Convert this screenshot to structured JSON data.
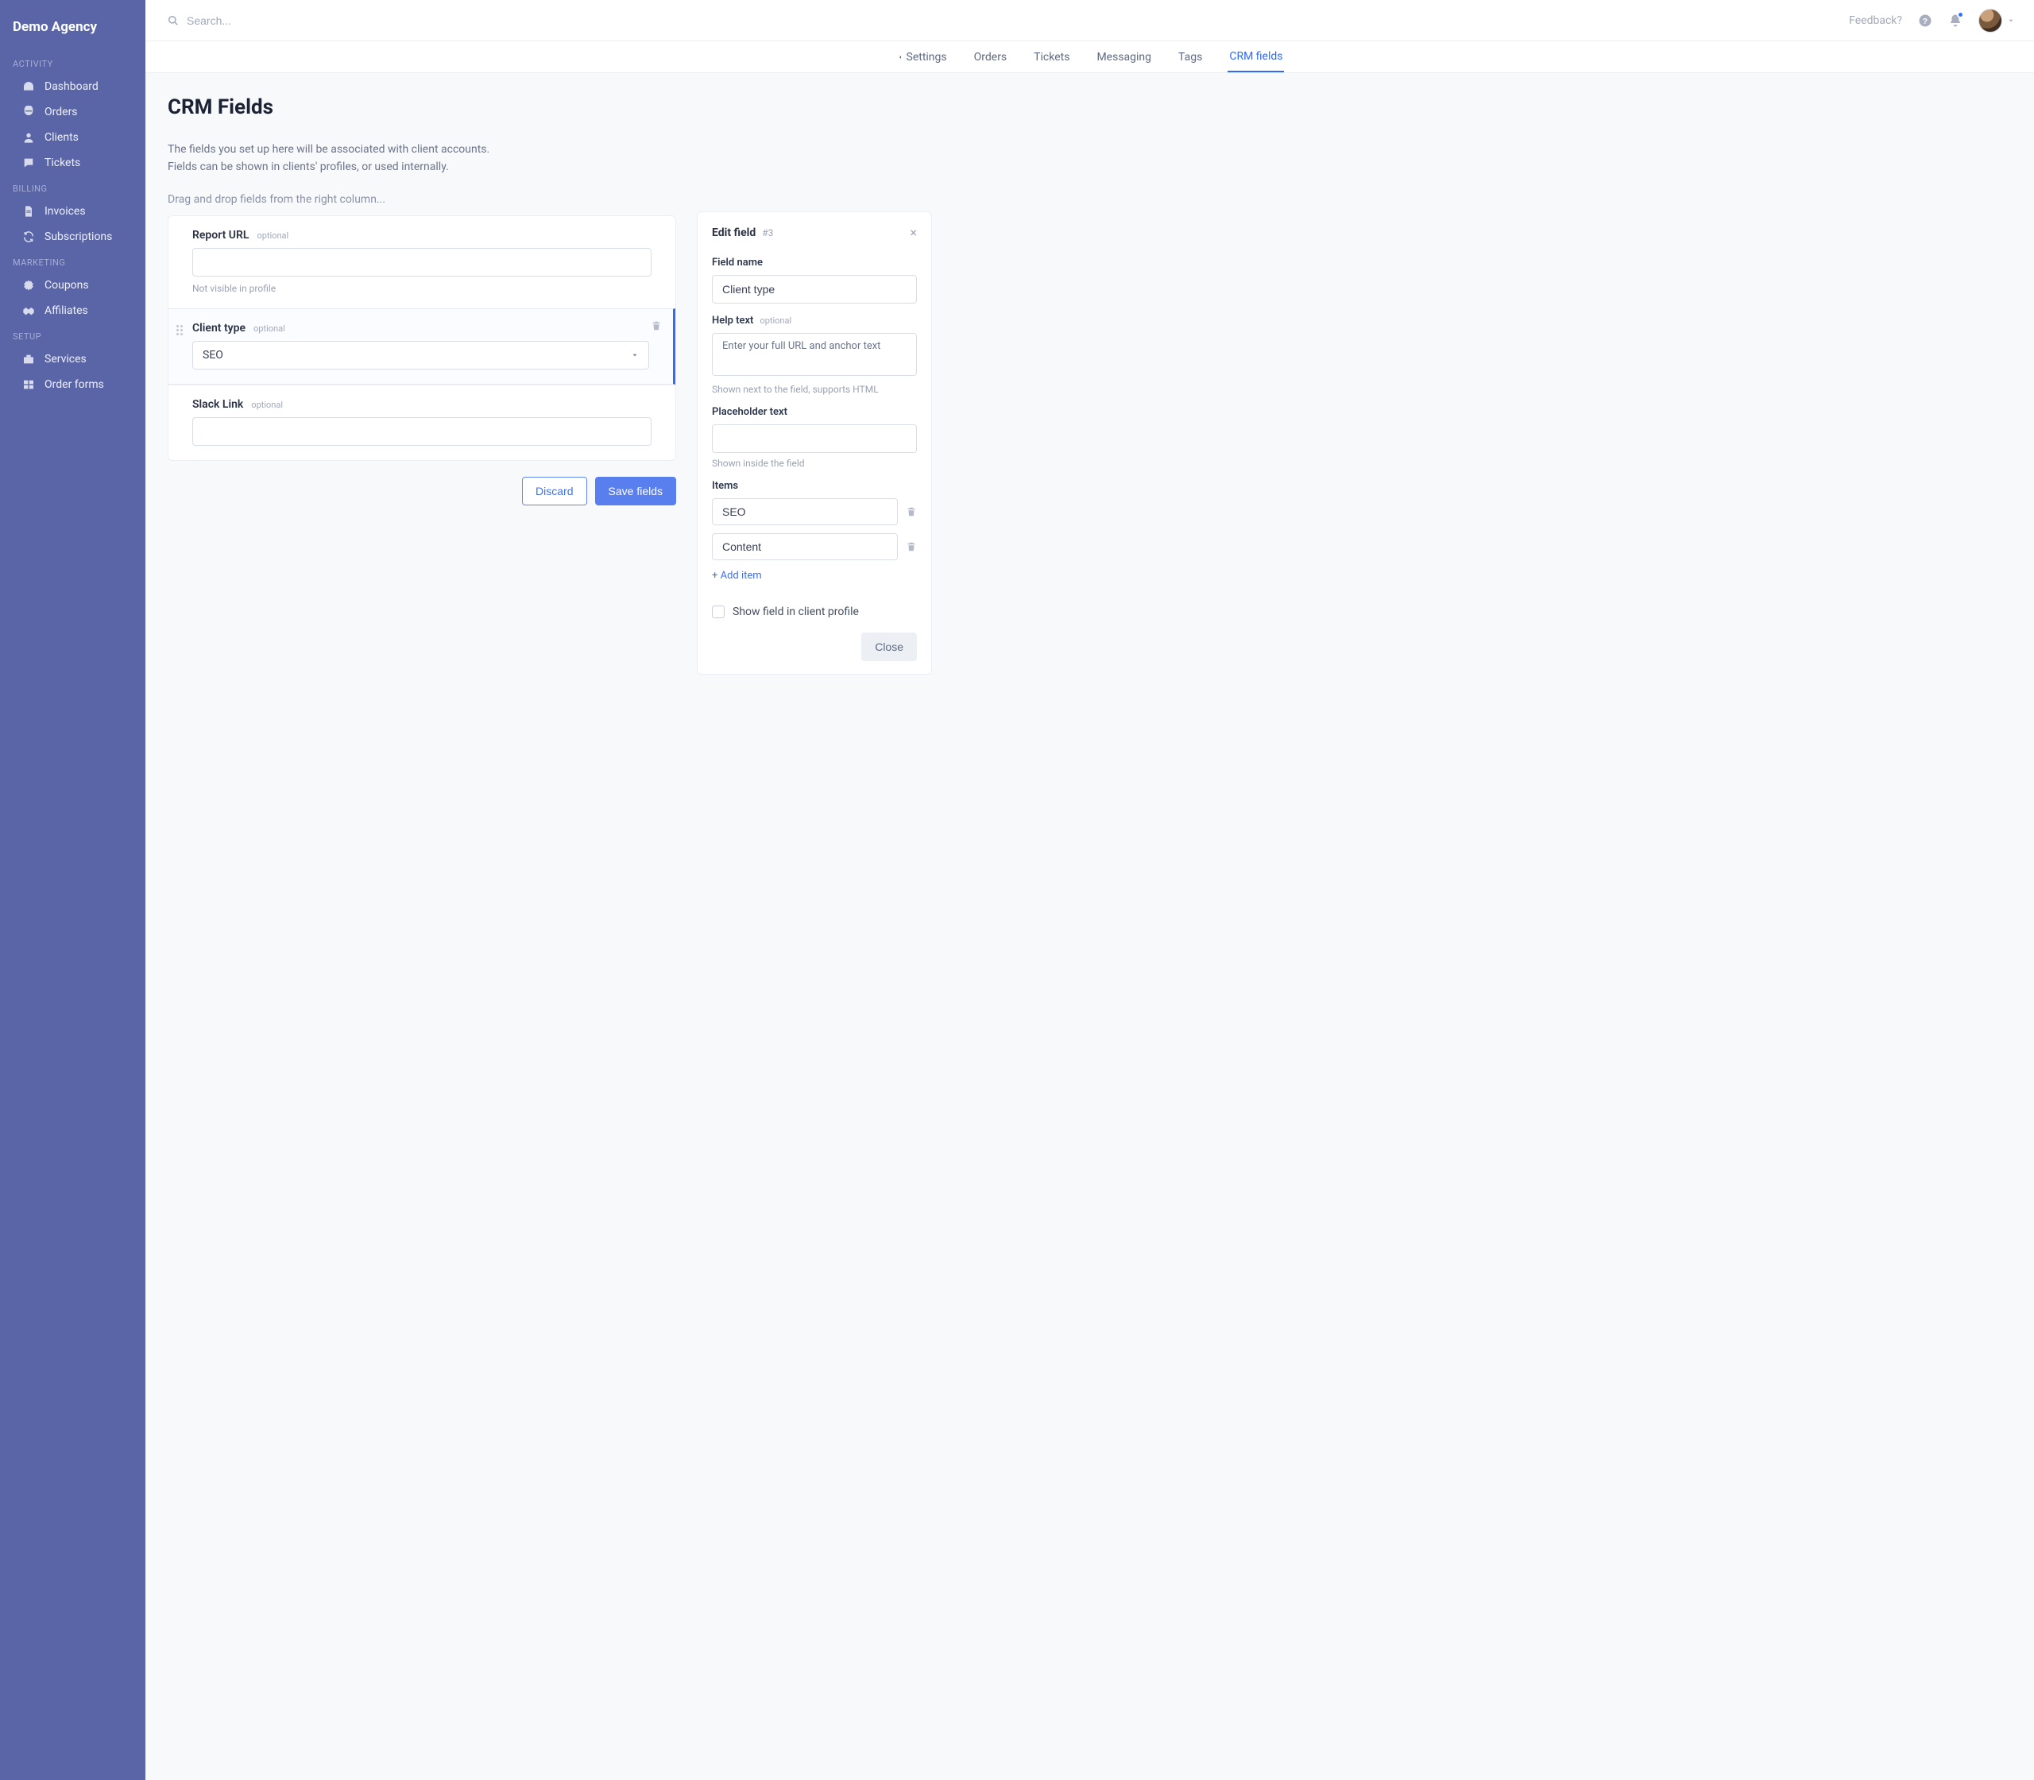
{
  "brand": "Demo Agency",
  "search": {
    "placeholder": "Search..."
  },
  "topbar": {
    "feedback": "Feedback?"
  },
  "sidebar": {
    "sections": [
      {
        "label": "ACTIVITY",
        "items": [
          {
            "icon": "gauge",
            "label": "Dashboard"
          },
          {
            "icon": "dashboard",
            "label": "Orders"
          },
          {
            "icon": "user",
            "label": "Clients"
          },
          {
            "icon": "comment",
            "label": "Tickets"
          }
        ]
      },
      {
        "label": "BILLING",
        "items": [
          {
            "icon": "file",
            "label": "Invoices"
          },
          {
            "icon": "refresh",
            "label": "Subscriptions"
          }
        ]
      },
      {
        "label": "MARKETING",
        "items": [
          {
            "icon": "cog",
            "label": "Coupons"
          },
          {
            "icon": "handshake",
            "label": "Affiliates"
          }
        ]
      },
      {
        "label": "SETUP",
        "items": [
          {
            "icon": "toolbox",
            "label": "Services"
          },
          {
            "icon": "grid",
            "label": "Order forms"
          }
        ]
      }
    ]
  },
  "tabs": {
    "settings": "Settings",
    "items": [
      "Orders",
      "Tickets",
      "Messaging",
      "Tags",
      "CRM fields"
    ],
    "active": "CRM fields"
  },
  "page": {
    "title": "CRM Fields",
    "desc1": "The fields you set up here will be associated with client accounts.",
    "desc2": "Fields can be shown in clients' profiles, or used internally.",
    "drag_hint": "Drag and drop fields from the right column..."
  },
  "fields": [
    {
      "label": "Report URL",
      "optional": "optional",
      "type": "text",
      "value": "",
      "note": "Not visible in profile",
      "selected": false
    },
    {
      "label": "Client type",
      "optional": "optional",
      "type": "select",
      "value": "SEO",
      "selected": true
    },
    {
      "label": "Slack Link",
      "optional": "optional",
      "type": "text",
      "value": "",
      "selected": false
    }
  ],
  "actions": {
    "discard": "Discard",
    "save": "Save fields"
  },
  "editPanel": {
    "title": "Edit field",
    "index": "#3",
    "fieldName": {
      "label": "Field name",
      "value": "Client type"
    },
    "helpText": {
      "label": "Help text",
      "optional": "optional",
      "value": "Enter your full URL and anchor text",
      "helper": "Shown next to the field, supports HTML"
    },
    "placeholder": {
      "label": "Placeholder text",
      "value": "",
      "helper": "Shown inside the field"
    },
    "items": {
      "label": "Items",
      "values": [
        "SEO",
        "Content"
      ],
      "add": "+ Add item"
    },
    "showInProfile": "Show field in client profile",
    "close": "Close"
  }
}
